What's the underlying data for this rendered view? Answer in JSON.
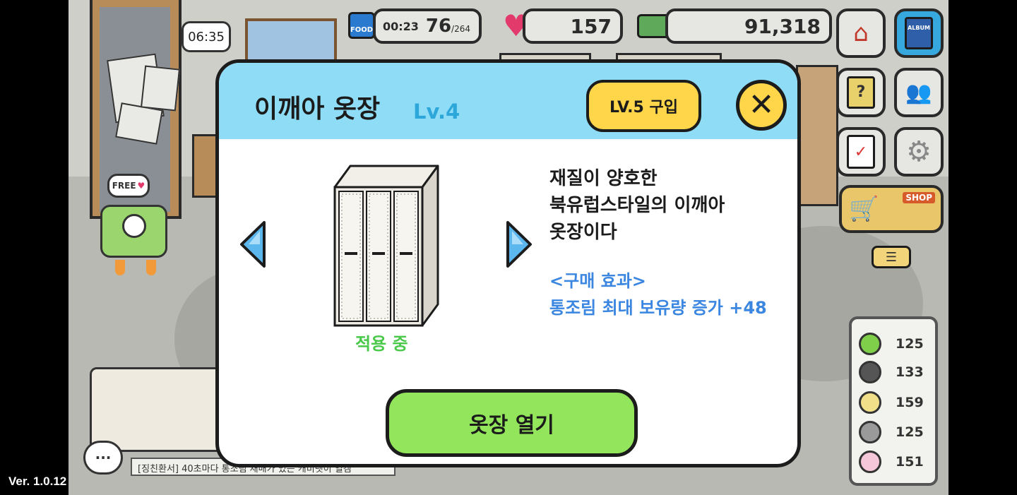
{
  "version": "Ver. 1.0.12",
  "hud": {
    "clock": "06:35",
    "food_icon_label": "FOOD",
    "food_timer": "00:23",
    "food_count": "76",
    "food_max": "/264",
    "hearts": "157",
    "money": "91,318"
  },
  "side_buttons": {
    "album_label": "ALBUM",
    "shop_label": "SHOP"
  },
  "free_bubble": "FREE",
  "resources": [
    {
      "value": "125",
      "color": "#7fcf4a",
      "icon": "green-seed-icon"
    },
    {
      "value": "133",
      "color": "#555555",
      "icon": "black-seed-icon"
    },
    {
      "value": "159",
      "color": "#f2df8a",
      "icon": "yellow-seed-icon"
    },
    {
      "value": "125",
      "color": "#9a9a9a",
      "icon": "gray-seed-icon"
    },
    {
      "value": "151",
      "color": "#f6c7d8",
      "icon": "pink-seed-icon"
    }
  ],
  "chat": {
    "icon_text": "···",
    "message": "[징친환서] 40초마다 통조림 재배가 있는 캐비넷이 얼캠"
  },
  "dialog": {
    "title": "이깨아 옷장",
    "level": "Lv.4",
    "buy_button": "LV.5 구입",
    "close_button": "✕",
    "status": "적용 중",
    "description": [
      "재질이 양호한",
      "북유럽스타일의 이깨아",
      "옷장이다"
    ],
    "effect_title": "<구매 효과>",
    "effect_text": "통조림 최대 보유량 증가 +48",
    "open_button": "옷장 열기"
  },
  "colors": {
    "header": "#8fdcf6",
    "accent_yellow": "#ffd649",
    "open_button": "#93e65b",
    "status_green": "#49c84a",
    "effect_blue": "#3a86e0"
  }
}
